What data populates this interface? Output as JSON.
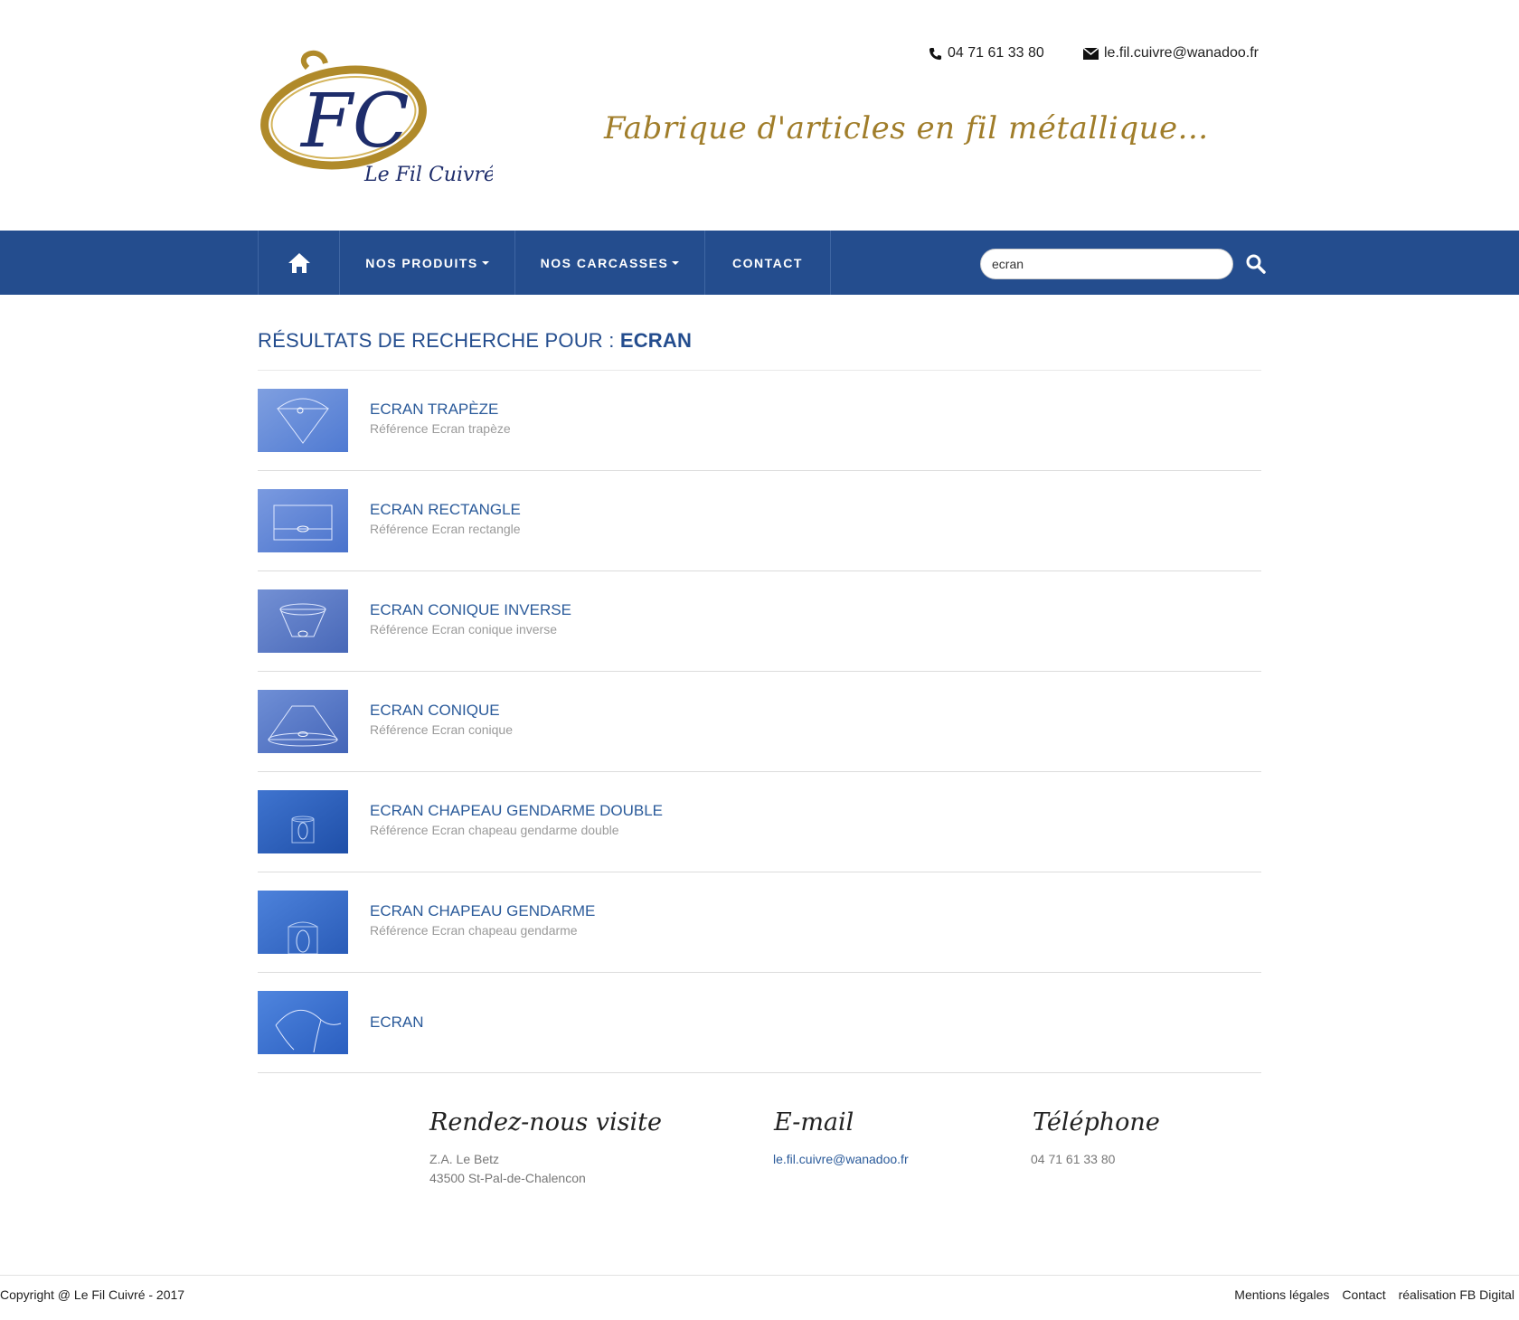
{
  "header": {
    "brand": "Le Fil Cuivré",
    "phone": "04 71 61 33 80",
    "email": "le.fil.cuivre@wanadoo.fr",
    "tagline": "Fabrique d'articles en fil métallique..."
  },
  "nav": {
    "home_icon": "home-icon",
    "items": [
      "NOS PRODUITS",
      "NOS CARCASSES",
      "CONTACT"
    ],
    "search_value": "ecran",
    "search_icon": "search-icon",
    "color": "#244d8e"
  },
  "results": {
    "title_prefix": "RÉSULTATS DE RECHERCHE POUR :",
    "query": "ECRAN",
    "items": [
      {
        "title": "ECRAN TRAPÈZE",
        "ref": "Référence Ecran trapèze"
      },
      {
        "title": "ECRAN RECTANGLE",
        "ref": "Référence Ecran rectangle"
      },
      {
        "title": "ECRAN CONIQUE INVERSE",
        "ref": "Référence Ecran conique inverse"
      },
      {
        "title": "ECRAN CONIQUE",
        "ref": "Référence Ecran conique"
      },
      {
        "title": "ECRAN CHAPEAU GENDARME DOUBLE",
        "ref": "Référence Ecran chapeau gendarme double"
      },
      {
        "title": "ECRAN CHAPEAU GENDARME",
        "ref": "Référence Ecran chapeau gendarme"
      },
      {
        "title": "ECRAN",
        "ref": ""
      }
    ]
  },
  "footer": {
    "visit_heading": "Rendez-nous visite",
    "address_line1": "Z.A. Le Betz",
    "address_line2": "43500 St-Pal-de-Chalencon",
    "email_heading": "E-mail",
    "email": "le.fil.cuivre@wanadoo.fr",
    "phone_heading": "Téléphone",
    "phone": "04 71 61 33 80",
    "copyright": "Copyright @ Le Fil Cuivré - 2017",
    "links": [
      "Mentions légales",
      "Contact",
      "réalisation FB Digital"
    ]
  }
}
